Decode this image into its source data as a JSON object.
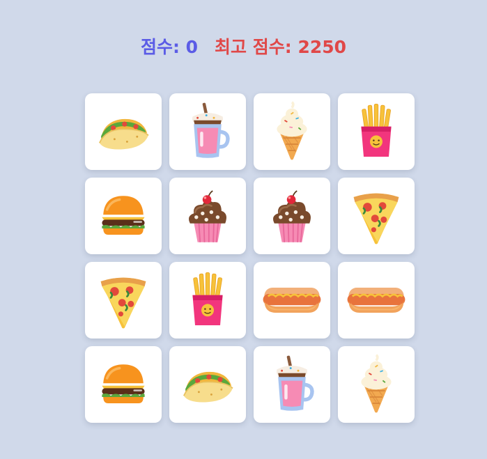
{
  "header": {
    "score_label": "점수: 0",
    "best_label": "최고 점수: 2250"
  },
  "colors": {
    "background": "#d0d9ea",
    "score": "#5b5ce6",
    "best": "#e04848",
    "card": "#ffffff"
  },
  "board": {
    "cards": [
      {
        "food": "taco"
      },
      {
        "food": "milkshake"
      },
      {
        "food": "ice-cream"
      },
      {
        "food": "fries"
      },
      {
        "food": "burger"
      },
      {
        "food": "cupcake"
      },
      {
        "food": "cupcake"
      },
      {
        "food": "pizza"
      },
      {
        "food": "pizza"
      },
      {
        "food": "fries"
      },
      {
        "food": "hotdog"
      },
      {
        "food": "hotdog"
      },
      {
        "food": "burger"
      },
      {
        "food": "taco"
      },
      {
        "food": "milkshake"
      },
      {
        "food": "ice-cream"
      }
    ]
  }
}
